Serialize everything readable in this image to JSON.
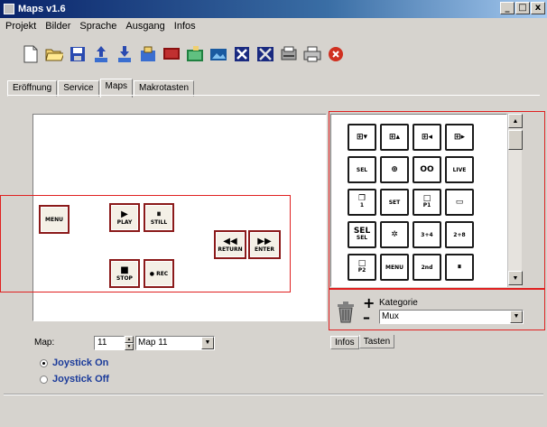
{
  "window": {
    "title": "Maps v1.6",
    "buttons": [
      "_",
      "□",
      "x"
    ]
  },
  "menu": [
    "Projekt",
    "Bilder",
    "Sprache",
    "Ausgang",
    "Infos"
  ],
  "toolbar_icons": [
    "new-file-icon",
    "open-folder-icon",
    "save-icon",
    "upload-icon",
    "download-icon",
    "import-icon",
    "monitor-icon",
    "image-edit-icon",
    "picture-icon",
    "delete-x-icon",
    "delete-all-icon",
    "scanner-icon",
    "print-icon",
    "stop-icon"
  ],
  "tabs": [
    "Eröffnung",
    "Service",
    "Maps",
    "Makrotasten"
  ],
  "active_tab": "Maps",
  "map_keys": [
    {
      "name": "menu",
      "label": "MENU",
      "symbol": ""
    },
    {
      "name": "play",
      "label": "PLAY",
      "symbol": "▶"
    },
    {
      "name": "still",
      "label": "STILL",
      "symbol": "⏸"
    },
    {
      "name": "return",
      "label": "RETURN",
      "symbol": "◀◀"
    },
    {
      "name": "enter",
      "label": "ENTER",
      "symbol": "▶▶"
    },
    {
      "name": "stop",
      "label": "STOP",
      "symbol": "■"
    },
    {
      "name": "rec",
      "label": "● REC",
      "symbol": ""
    }
  ],
  "palette_keys": [
    {
      "label": "",
      "symbol": "⊞▾"
    },
    {
      "label": "",
      "symbol": "⊞▴"
    },
    {
      "label": "",
      "symbol": "⊞◂"
    },
    {
      "label": "",
      "symbol": "⊞▸"
    },
    {
      "label": "SEL",
      "symbol": ""
    },
    {
      "label": "",
      "symbol": "⊕"
    },
    {
      "label": "",
      "symbol": "OO"
    },
    {
      "label": "LIVE",
      "symbol": ""
    },
    {
      "label": "1",
      "symbol": "❐"
    },
    {
      "label": "SET",
      "symbol": ""
    },
    {
      "label": "P1",
      "symbol": "□"
    },
    {
      "label": "",
      "symbol": "▭"
    },
    {
      "label": "SEL",
      "symbol": "SEL"
    },
    {
      "label": "",
      "symbol": "✲"
    },
    {
      "label": "3+4",
      "symbol": ""
    },
    {
      "label": "2+8",
      "symbol": ""
    },
    {
      "label": "P2",
      "symbol": "□"
    },
    {
      "label": "MENU",
      "symbol": ""
    },
    {
      "label": "2nd",
      "symbol": ""
    },
    {
      "label": "",
      "symbol": "⏸"
    }
  ],
  "category": {
    "plus": "+",
    "minus": "–",
    "label": "Kategorie",
    "selected": "Mux"
  },
  "right_tabs": [
    "Infos",
    "Tasten"
  ],
  "map_selector": {
    "label": "Map:",
    "number": "11",
    "selected": "Map 11"
  },
  "radios": [
    {
      "label": "Joystick On",
      "checked": true
    },
    {
      "label": "Joystick Off",
      "checked": false
    }
  ]
}
